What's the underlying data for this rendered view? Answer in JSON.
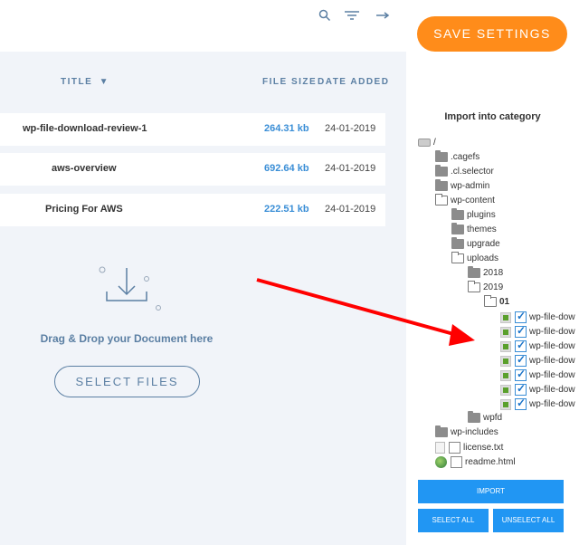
{
  "toolbar": {
    "search_icon": "search-icon",
    "filter_icon": "filter-icon",
    "arrow_icon": "arrow-right-icon"
  },
  "table": {
    "headers": {
      "title": "TITLE",
      "sort_indicator": "▼",
      "file_size": "FILE SIZE",
      "date_added": "DATE ADDED"
    },
    "rows": [
      {
        "title": "wp-file-download-review-1",
        "size": "264.31 kb",
        "date": "24-01-2019"
      },
      {
        "title": "aws-overview",
        "size": "692.64 kb",
        "date": "24-01-2019"
      },
      {
        "title": "Pricing For AWS",
        "size": "222.51 kb",
        "date": "24-01-2019"
      }
    ]
  },
  "dropzone": {
    "label": "Drag & Drop your Document here",
    "button": "SELECT FILES"
  },
  "right": {
    "save_button": "SAVE SETTINGS",
    "import_title": "Import into category",
    "tree": {
      "root": "/",
      "cagefs": ".cagefs",
      "cl_selector": ".cl.selector",
      "wp_admin": "wp-admin",
      "wp_content": "wp-content",
      "plugins": "plugins",
      "themes": "themes",
      "upgrade": "upgrade",
      "uploads": "uploads",
      "y2018": "2018",
      "y2019": "2019",
      "m01": "01",
      "files": [
        "wp-file-dow",
        "wp-file-dow",
        "wp-file-dow",
        "wp-file-dow",
        "wp-file-dow",
        "wp-file-dow",
        "wp-file-dow"
      ],
      "wpfd": "wpfd",
      "wp_includes": "wp-includes",
      "license": "license.txt",
      "readme": "readme.html"
    },
    "import_button": "IMPORT",
    "select_all": "SELECT ALL",
    "unselect_all": "UNSELECT ALL"
  },
  "colors": {
    "accent_orange": "#ff8c1a",
    "accent_blue": "#2196f3",
    "header_blue": "#5b7fa3",
    "size_blue": "#3a8ed6",
    "arrow_red": "#ff0000"
  }
}
